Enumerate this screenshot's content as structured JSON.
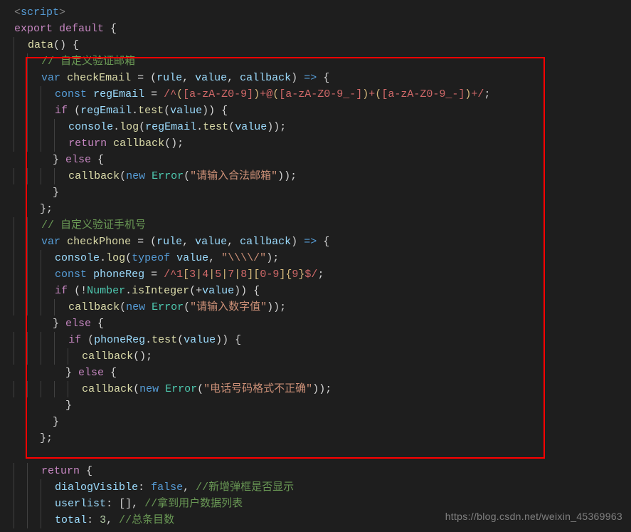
{
  "watermark": "https://blog.csdn.net/weixin_45369963",
  "lines": [
    [
      [
        "tag",
        "<"
      ],
      [
        "tagname",
        "script"
      ],
      [
        "tag",
        ">"
      ]
    ],
    [
      [
        "ctrl",
        "export"
      ],
      [
        "punc",
        " "
      ],
      [
        "ctrl",
        "default"
      ],
      [
        "punc",
        " {"
      ]
    ],
    [
      [
        "punc",
        "  "
      ],
      [
        "fn",
        "data"
      ],
      [
        "punc",
        "() {"
      ]
    ],
    [
      [
        "punc",
        "    "
      ],
      [
        "cmt",
        "// 自定义验证邮箱"
      ]
    ],
    [
      [
        "punc",
        "    "
      ],
      [
        "kw",
        "var"
      ],
      [
        "punc",
        " "
      ],
      [
        "fn",
        "checkEmail"
      ],
      [
        "punc",
        " = ("
      ],
      [
        "var",
        "rule"
      ],
      [
        "punc",
        ", "
      ],
      [
        "var",
        "value"
      ],
      [
        "punc",
        ", "
      ],
      [
        "var",
        "callback"
      ],
      [
        "punc",
        ") "
      ],
      [
        "kw",
        "=>"
      ],
      [
        "punc",
        " {"
      ]
    ],
    [
      [
        "punc",
        "      "
      ],
      [
        "kw",
        "const"
      ],
      [
        "punc",
        " "
      ],
      [
        "var",
        "regEmail"
      ],
      [
        "punc",
        " = "
      ],
      [
        "re",
        "/"
      ],
      [
        "re",
        "^"
      ],
      [
        "reesc",
        "("
      ],
      [
        "re",
        "[a-zA-Z0-9]"
      ],
      [
        "reesc",
        ")"
      ],
      [
        "re",
        "+@"
      ],
      [
        "reesc",
        "("
      ],
      [
        "re",
        "[a-zA-Z0-9_-]"
      ],
      [
        "reesc",
        ")"
      ],
      [
        "re",
        "+"
      ],
      [
        "reesc",
        "("
      ],
      [
        "re",
        "[a-zA-Z0-9_-]"
      ],
      [
        "reesc",
        ")"
      ],
      [
        "re",
        "+"
      ],
      [
        "re",
        "/"
      ],
      [
        "punc",
        ";"
      ]
    ],
    [
      [
        "punc",
        "      "
      ],
      [
        "ctrl",
        "if"
      ],
      [
        "punc",
        " ("
      ],
      [
        "var",
        "regEmail"
      ],
      [
        "punc",
        "."
      ],
      [
        "fn",
        "test"
      ],
      [
        "punc",
        "("
      ],
      [
        "var",
        "value"
      ],
      [
        "punc",
        ")) {"
      ]
    ],
    [
      [
        "punc",
        "        "
      ],
      [
        "var",
        "console"
      ],
      [
        "punc",
        "."
      ],
      [
        "fn",
        "log"
      ],
      [
        "punc",
        "("
      ],
      [
        "var",
        "regEmail"
      ],
      [
        "punc",
        "."
      ],
      [
        "fn",
        "test"
      ],
      [
        "punc",
        "("
      ],
      [
        "var",
        "value"
      ],
      [
        "punc",
        "));"
      ]
    ],
    [
      [
        "punc",
        "        "
      ],
      [
        "ctrl",
        "return"
      ],
      [
        "punc",
        " "
      ],
      [
        "fn",
        "callback"
      ],
      [
        "punc",
        "();"
      ]
    ],
    [
      [
        "punc",
        "      } "
      ],
      [
        "ctrl",
        "else"
      ],
      [
        "punc",
        " {"
      ]
    ],
    [
      [
        "punc",
        "        "
      ],
      [
        "fn",
        "callback"
      ],
      [
        "punc",
        "("
      ],
      [
        "kw",
        "new"
      ],
      [
        "punc",
        " "
      ],
      [
        "cls",
        "Error"
      ],
      [
        "punc",
        "("
      ],
      [
        "str",
        "\"请输入合法邮箱\""
      ],
      [
        "punc",
        "));"
      ]
    ],
    [
      [
        "punc",
        "      }"
      ]
    ],
    [
      [
        "punc",
        "    };"
      ]
    ],
    [
      [
        "punc",
        "    "
      ],
      [
        "cmt",
        "// 自定义验证手机号"
      ]
    ],
    [
      [
        "punc",
        "    "
      ],
      [
        "kw",
        "var"
      ],
      [
        "punc",
        " "
      ],
      [
        "fn",
        "checkPhone"
      ],
      [
        "punc",
        " = ("
      ],
      [
        "var",
        "rule"
      ],
      [
        "punc",
        ", "
      ],
      [
        "var",
        "value"
      ],
      [
        "punc",
        ", "
      ],
      [
        "var",
        "callback"
      ],
      [
        "punc",
        ") "
      ],
      [
        "kw",
        "=>"
      ],
      [
        "punc",
        " {"
      ]
    ],
    [
      [
        "punc",
        "      "
      ],
      [
        "var",
        "console"
      ],
      [
        "punc",
        "."
      ],
      [
        "fn",
        "log"
      ],
      [
        "punc",
        "("
      ],
      [
        "kw",
        "typeof"
      ],
      [
        "punc",
        " "
      ],
      [
        "var",
        "value"
      ],
      [
        "punc",
        ", "
      ],
      [
        "str",
        "\"\\\\\\\\/\""
      ],
      [
        "punc",
        ");"
      ]
    ],
    [
      [
        "punc",
        "      "
      ],
      [
        "kw",
        "const"
      ],
      [
        "punc",
        " "
      ],
      [
        "var",
        "phoneReg"
      ],
      [
        "punc",
        " = "
      ],
      [
        "re",
        "/"
      ],
      [
        "re",
        "^1"
      ],
      [
        "reesc",
        "["
      ],
      [
        "re",
        "3"
      ],
      [
        "reesc",
        "|"
      ],
      [
        "re",
        "4"
      ],
      [
        "reesc",
        "|"
      ],
      [
        "re",
        "5"
      ],
      [
        "reesc",
        "|"
      ],
      [
        "re",
        "7"
      ],
      [
        "reesc",
        "|"
      ],
      [
        "re",
        "8"
      ],
      [
        "reesc",
        "]"
      ],
      [
        "reesc",
        "["
      ],
      [
        "re",
        "0-9"
      ],
      [
        "reesc",
        "]"
      ],
      [
        "reesc",
        "{"
      ],
      [
        "re",
        "9"
      ],
      [
        "reesc",
        "}"
      ],
      [
        "re",
        "$"
      ],
      [
        "re",
        "/"
      ],
      [
        "punc",
        ";"
      ]
    ],
    [
      [
        "punc",
        "      "
      ],
      [
        "ctrl",
        "if"
      ],
      [
        "punc",
        " (!"
      ],
      [
        "cls",
        "Number"
      ],
      [
        "punc",
        "."
      ],
      [
        "fn",
        "isInteger"
      ],
      [
        "punc",
        "(+"
      ],
      [
        "var",
        "value"
      ],
      [
        "punc",
        ")) {"
      ]
    ],
    [
      [
        "punc",
        "        "
      ],
      [
        "fn",
        "callback"
      ],
      [
        "punc",
        "("
      ],
      [
        "kw",
        "new"
      ],
      [
        "punc",
        " "
      ],
      [
        "cls",
        "Error"
      ],
      [
        "punc",
        "("
      ],
      [
        "str",
        "\"请输入数字值\""
      ],
      [
        "punc",
        "));"
      ]
    ],
    [
      [
        "punc",
        "      } "
      ],
      [
        "ctrl",
        "else"
      ],
      [
        "punc",
        " {"
      ]
    ],
    [
      [
        "punc",
        "        "
      ],
      [
        "ctrl",
        "if"
      ],
      [
        "punc",
        " ("
      ],
      [
        "var",
        "phoneReg"
      ],
      [
        "punc",
        "."
      ],
      [
        "fn",
        "test"
      ],
      [
        "punc",
        "("
      ],
      [
        "var",
        "value"
      ],
      [
        "punc",
        ")) {"
      ]
    ],
    [
      [
        "punc",
        "          "
      ],
      [
        "fn",
        "callback"
      ],
      [
        "punc",
        "();"
      ]
    ],
    [
      [
        "punc",
        "        } "
      ],
      [
        "ctrl",
        "else"
      ],
      [
        "punc",
        " {"
      ]
    ],
    [
      [
        "punc",
        "          "
      ],
      [
        "fn",
        "callback"
      ],
      [
        "punc",
        "("
      ],
      [
        "kw",
        "new"
      ],
      [
        "punc",
        " "
      ],
      [
        "cls",
        "Error"
      ],
      [
        "punc",
        "("
      ],
      [
        "str",
        "\"电话号码格式不正确\""
      ],
      [
        "punc",
        "));"
      ]
    ],
    [
      [
        "punc",
        "        }"
      ]
    ],
    [
      [
        "punc",
        "      }"
      ]
    ],
    [
      [
        "punc",
        "    };"
      ]
    ],
    [
      [
        "punc",
        ""
      ]
    ],
    [
      [
        "punc",
        "    "
      ],
      [
        "ctrl",
        "return"
      ],
      [
        "punc",
        " {"
      ]
    ],
    [
      [
        "punc",
        "      "
      ],
      [
        "var",
        "dialogVisible"
      ],
      [
        "punc",
        ": "
      ],
      [
        "bool",
        "false"
      ],
      [
        "punc",
        ", "
      ],
      [
        "cmt",
        "//新增弹框是否显示"
      ]
    ],
    [
      [
        "punc",
        "      "
      ],
      [
        "var",
        "userlist"
      ],
      [
        "punc",
        ": [], "
      ],
      [
        "cmt",
        "//拿到用户数据列表"
      ]
    ],
    [
      [
        "punc",
        "      "
      ],
      [
        "var",
        "total"
      ],
      [
        "punc",
        ": "
      ],
      [
        "num",
        "3"
      ],
      [
        "punc",
        ", "
      ],
      [
        "cmt",
        "//总条目数"
      ]
    ]
  ]
}
